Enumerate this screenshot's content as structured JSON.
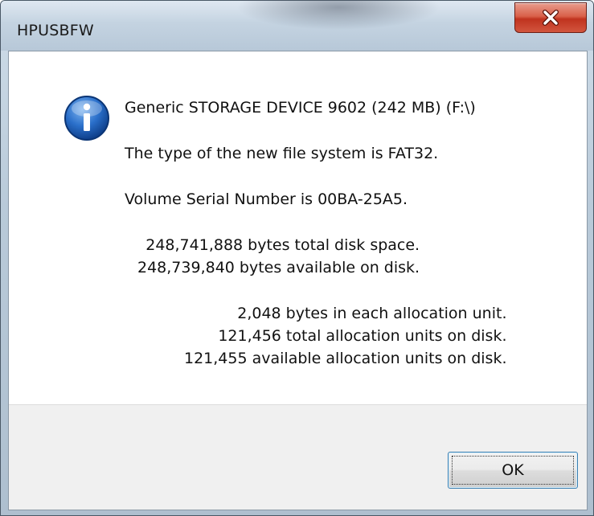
{
  "window": {
    "title": "HPUSBFW"
  },
  "message": {
    "icon": "info-icon",
    "device": "Generic STORAGE DEVICE 9602 (242 MB) (F:\\)",
    "file_system": "The type of the new file system is FAT32.",
    "serial": "Volume Serial Number is 00BA-25A5.",
    "disk_space": [
      "248,741,888 bytes total disk space.",
      "248,739,840 bytes available on disk."
    ],
    "allocation": [
      "2,048 bytes in each allocation unit.",
      "121,456 total allocation units on disk.",
      "121,455 available allocation units on disk."
    ]
  },
  "buttons": {
    "ok_label": "OK",
    "close_icon": "close-icon"
  },
  "colors": {
    "close_button": "#c0331f",
    "info_icon": "#1c5fb8",
    "ok_border": "#3c7fb1"
  }
}
